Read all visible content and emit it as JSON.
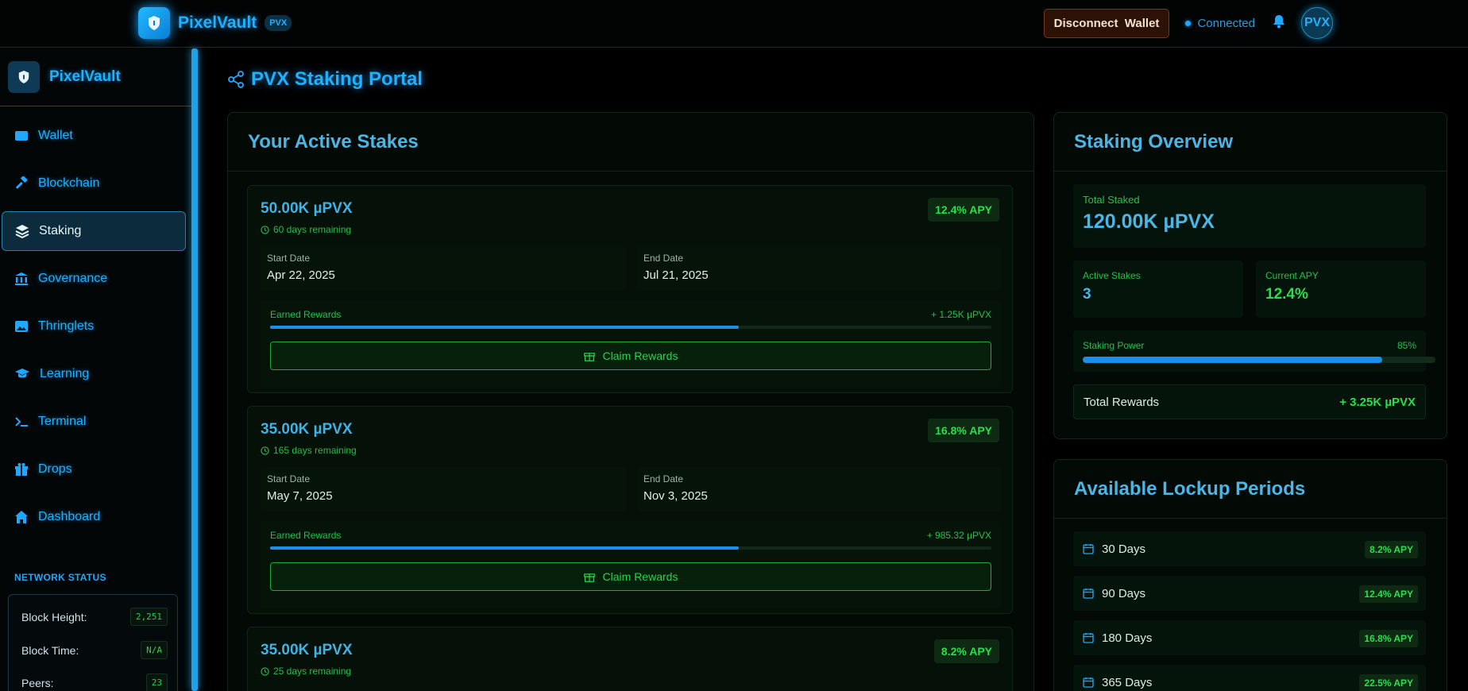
{
  "header": {
    "brand_name": "PixelVault",
    "brand_badge": "PVX",
    "disconnect_label": "Disconnect  Wallet",
    "connection_status": "Connected",
    "avatar_text": "PVX"
  },
  "sidebar": {
    "brand_name": "PixelVault",
    "items": [
      {
        "label": "Wallet",
        "icon": "wallet-icon"
      },
      {
        "label": "Blockchain",
        "icon": "hammer-icon"
      },
      {
        "label": "Staking",
        "icon": "layers-icon",
        "active": true
      },
      {
        "label": "Governance",
        "icon": "bank-icon"
      },
      {
        "label": "Thringlets",
        "icon": "image-icon"
      },
      {
        "label": "Learning",
        "icon": "graduation-cap-icon"
      },
      {
        "label": "Terminal",
        "icon": "terminal-icon"
      },
      {
        "label": "Drops",
        "icon": "gift-icon"
      },
      {
        "label": "Dashboard",
        "icon": "home-icon"
      }
    ],
    "network_status": {
      "title": "NETWORK STATUS",
      "rows": [
        {
          "label": "Block Height:",
          "value": "2,251"
        },
        {
          "label": "Block Time:",
          "value": "N/A"
        },
        {
          "label": "Peers:",
          "value": "23"
        }
      ]
    }
  },
  "page": {
    "title": "PVX Staking Portal"
  },
  "active_stakes": {
    "title": "Your Active Stakes",
    "start_label": "Start Date",
    "end_label": "End Date",
    "rewards_label": "Earned Rewards",
    "claim_label": "Claim Rewards",
    "stakes": [
      {
        "amount": "50.00K µPVX",
        "days_remaining": "60 days remaining",
        "apy": "12.4% APY",
        "start": "Apr 22, 2025",
        "end": "Jul 21, 2025",
        "rewards": "+ 1.25K µPVX",
        "progress": 0.65
      },
      {
        "amount": "35.00K µPVX",
        "days_remaining": "165 days remaining",
        "apy": "16.8% APY",
        "start": "May 7, 2025",
        "end": "Nov 3, 2025",
        "rewards": "+ 985.32 µPVX",
        "progress": 0.65
      },
      {
        "amount": "35.00K µPVX",
        "days_remaining": "25 days remaining",
        "apy": "8.2% APY"
      }
    ]
  },
  "overview": {
    "title": "Staking Overview",
    "total_staked_label": "Total Staked",
    "total_staked": "120.00K µPVX",
    "active_stakes_label": "Active Stakes",
    "active_stakes": "3",
    "current_apy_label": "Current APY",
    "current_apy": "12.4%",
    "staking_power_label": "Staking Power",
    "staking_power": "85%",
    "staking_power_value": 0.85,
    "total_rewards_label": "Total Rewards",
    "total_rewards": "+ 3.25K µPVX"
  },
  "lockup": {
    "title": "Available Lockup Periods",
    "periods": [
      {
        "days": "30 Days",
        "apy": "8.2% APY"
      },
      {
        "days": "90 Days",
        "apy": "12.4% APY"
      },
      {
        "days": "180 Days",
        "apy": "16.8% APY"
      },
      {
        "days": "365 Days",
        "apy": "22.5% APY"
      }
    ]
  },
  "colors": {
    "accent_blue": "#1fb0ff",
    "accent_green": "#26e04a",
    "disconnect_bg": "#2b1106"
  }
}
